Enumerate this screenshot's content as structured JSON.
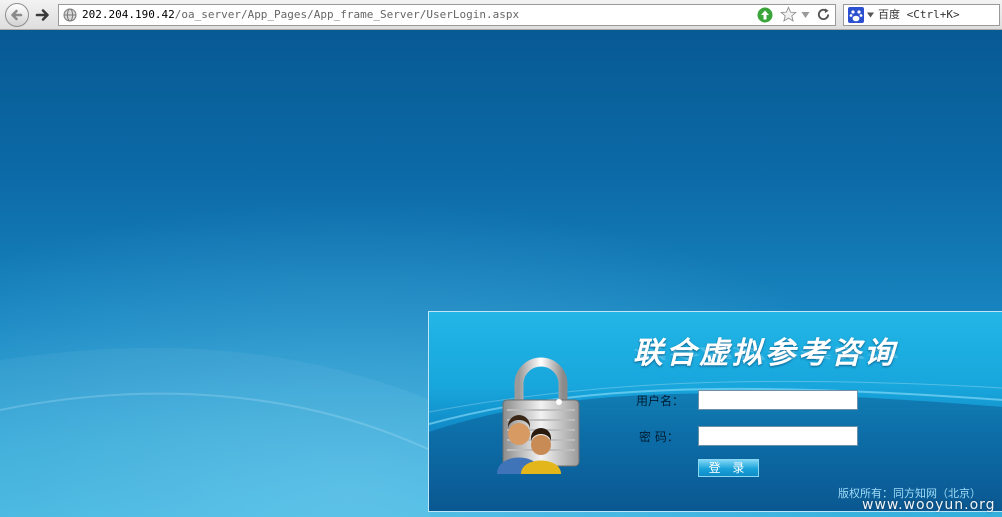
{
  "browser": {
    "url_host": "202.204.190.42",
    "url_path": "/oa_server/App_Pages/App_frame_Server/UserLogin.aspx",
    "search_placeholder": "百度 <Ctrl+K>",
    "icons": [
      "back-icon",
      "forward-icon",
      "globe-icon",
      "go-icon",
      "star-icon",
      "dropdown-icon",
      "reload-icon",
      "baidu-icon"
    ]
  },
  "login": {
    "title": "联合虚拟参考咨询",
    "username_label": "用户名：",
    "username_value": "",
    "password_label": "密 码：",
    "password_value": "",
    "login_button": "登 录",
    "copyright": "版权所有：同方知网（北京）"
  },
  "watermark": "www.wooyun.org",
  "colors": {
    "page_bg_top": "#075a94",
    "page_bg_bottom": "#35b0dd",
    "panel_bg": "#18a6dc",
    "copyright_text": "#9fdcf8"
  }
}
